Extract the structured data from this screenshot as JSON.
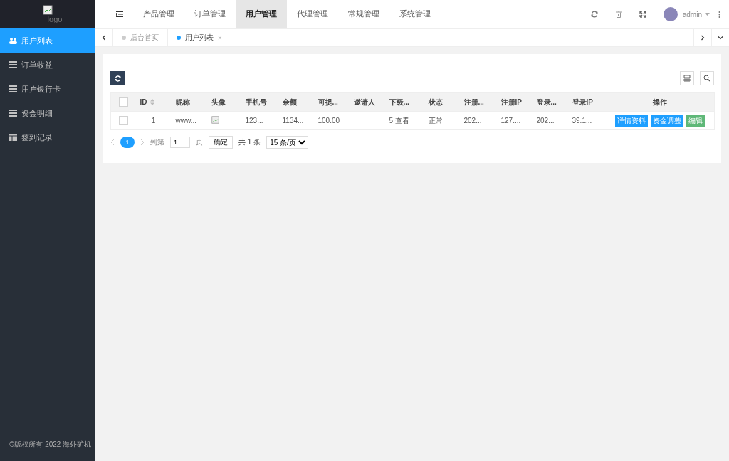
{
  "logo": {
    "alt": "logo"
  },
  "sidebar": {
    "items": [
      {
        "label": "用户列表",
        "selected": true
      },
      {
        "label": "订单收益",
        "selected": false
      },
      {
        "label": "用户银行卡",
        "selected": false
      },
      {
        "label": "资金明细",
        "selected": false
      },
      {
        "label": "签到记录",
        "selected": false
      }
    ],
    "footer": "©版权所有 2022 海外矿机"
  },
  "topnav": {
    "items": [
      {
        "label": "产品管理",
        "selected": false
      },
      {
        "label": "订单管理",
        "selected": false
      },
      {
        "label": "用户管理",
        "selected": true
      },
      {
        "label": "代理管理",
        "selected": false
      },
      {
        "label": "常规管理",
        "selected": false
      },
      {
        "label": "系统管理",
        "selected": false
      }
    ],
    "user": "admin"
  },
  "tabs": [
    {
      "label": "后台首页",
      "selected": false
    },
    {
      "label": "用户列表",
      "selected": true,
      "close": "×"
    }
  ],
  "table": {
    "select_all_checked": false,
    "columns": [
      {
        "label": "ID",
        "sortable": true
      },
      {
        "label": "昵称",
        "sortable": false
      },
      {
        "label": "头像",
        "sortable": false
      },
      {
        "label": "手机号",
        "sortable": false
      },
      {
        "label": "余额",
        "sortable": false
      },
      {
        "label": "可提...",
        "sortable": false
      },
      {
        "label": "邀请人",
        "sortable": false
      },
      {
        "label": "下级...",
        "sortable": false
      },
      {
        "label": "状态",
        "sortable": false
      },
      {
        "label": "注册...",
        "sortable": false
      },
      {
        "label": "注册IP",
        "sortable": false
      },
      {
        "label": "登录...",
        "sortable": false
      },
      {
        "label": "登录IP",
        "sortable": false
      },
      {
        "label": "操作",
        "sortable": false
      }
    ],
    "rows": [
      {
        "checked": false,
        "cells": [
          {
            "kind": "text",
            "text": "1"
          },
          {
            "kind": "text",
            "text": "www..."
          },
          {
            "kind": "image"
          },
          {
            "kind": "text",
            "text": "123..."
          },
          {
            "kind": "text",
            "text": "1134..."
          },
          {
            "kind": "text",
            "text": "100.00"
          },
          {
            "kind": "empty"
          },
          {
            "kind": "text",
            "text": "5 查看"
          },
          {
            "kind": "text",
            "text": "正常"
          },
          {
            "kind": "text",
            "text": "202..."
          },
          {
            "kind": "text",
            "text": "127...."
          },
          {
            "kind": "text",
            "text": "202..."
          },
          {
            "kind": "text",
            "text": "39.1..."
          }
        ],
        "actions": [
          {
            "label": "详情资料",
            "color": "#1e9fff"
          },
          {
            "label": "资金调整",
            "color": "#1e9fff"
          },
          {
            "label": "编辑",
            "color": "#5fb878"
          }
        ]
      }
    ]
  },
  "pagination": {
    "pages": [
      {
        "label": "1",
        "selected": true
      }
    ],
    "goto_label": "到第",
    "goto_value": "1",
    "page_unit": "页",
    "confirm": "确定",
    "total": "共 1 条",
    "page_size": "15 条/页"
  }
}
